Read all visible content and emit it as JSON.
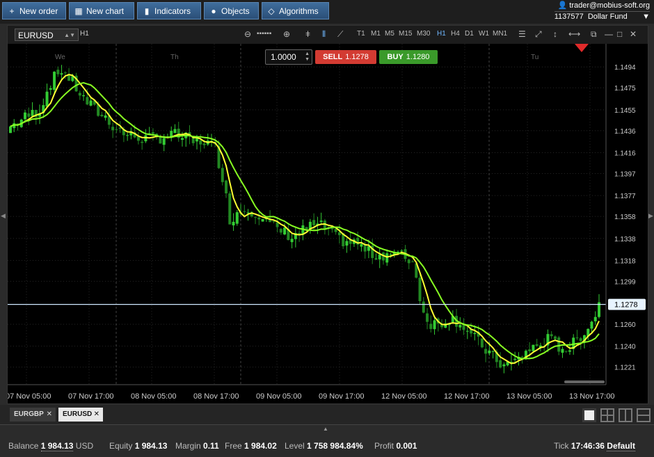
{
  "toolbar": {
    "new_order": "New order",
    "new_chart": "New chart",
    "indicators": "Indicators",
    "objects": "Objects",
    "algorithms": "Algorithms"
  },
  "account": {
    "user": "trader@mobius-soft.org",
    "number": "1137577",
    "name": "Dollar Fund"
  },
  "chart": {
    "symbol": "EURUSD",
    "timeframe": "H1",
    "timeframes": [
      "T1",
      "M1",
      "M5",
      "M15",
      "M30",
      "H1",
      "H4",
      "D1",
      "W1",
      "MN1"
    ],
    "active_timeframe": "H1"
  },
  "trade": {
    "quantity": "1.0000",
    "sell_label": "SELL",
    "sell_price": "1.1278",
    "buy_label": "BUY",
    "buy_price": "1.1280"
  },
  "chart_data": {
    "type": "candlestick",
    "symbol": "EURUSD",
    "timeframe": "H1",
    "current_price": 1.1278,
    "ylim": [
      1.1205,
      1.1515
    ],
    "y_ticks": [
      "1.1494",
      "1.1475",
      "1.1455",
      "1.1436",
      "1.1416",
      "1.1397",
      "1.1377",
      "1.1358",
      "1.1338",
      "1.1318",
      "1.1299",
      "1.1260",
      "1.1240",
      "1.1221"
    ],
    "x_ticks": [
      "07 Nov 05:00",
      "07 Nov 17:00",
      "08 Nov 05:00",
      "08 Nov 17:00",
      "09 Nov 05:00",
      "09 Nov 17:00",
      "12 Nov 05:00",
      "12 Nov 17:00",
      "13 Nov 05:00",
      "13 Nov 17:00"
    ],
    "day_labels": [
      "We",
      "Th",
      "Tu"
    ],
    "price_path": [
      [
        0,
        1.144
      ],
      [
        4,
        1.1448
      ],
      [
        8,
        1.1455
      ],
      [
        11,
        1.148
      ],
      [
        14,
        1.1492
      ],
      [
        17,
        1.148
      ],
      [
        20,
        1.1465
      ],
      [
        23,
        1.1455
      ],
      [
        26,
        1.1448
      ],
      [
        29,
        1.1438
      ],
      [
        32,
        1.1432
      ],
      [
        35,
        1.143
      ],
      [
        38,
        1.1428
      ],
      [
        41,
        1.143
      ],
      [
        44,
        1.1433
      ],
      [
        47,
        1.143
      ],
      [
        50,
        1.1425
      ],
      [
        53,
        1.1427
      ],
      [
        56,
        1.142
      ],
      [
        58,
        1.1395
      ],
      [
        60,
        1.1355
      ],
      [
        62,
        1.1362
      ],
      [
        65,
        1.1366
      ],
      [
        68,
        1.136
      ],
      [
        71,
        1.135
      ],
      [
        74,
        1.1345
      ],
      [
        77,
        1.134
      ],
      [
        80,
        1.1345
      ],
      [
        83,
        1.135
      ],
      [
        86,
        1.1348
      ],
      [
        89,
        1.1338
      ],
      [
        92,
        1.1335
      ],
      [
        95,
        1.1333
      ],
      [
        98,
        1.1325
      ],
      [
        101,
        1.1323
      ],
      [
        104,
        1.1325
      ],
      [
        107,
        1.1322
      ],
      [
        110,
        1.1318
      ],
      [
        112,
        1.1285
      ],
      [
        114,
        1.1262
      ],
      [
        117,
        1.126
      ],
      [
        120,
        1.1266
      ],
      [
        123,
        1.1262
      ],
      [
        126,
        1.125
      ],
      [
        129,
        1.124
      ],
      [
        132,
        1.123
      ],
      [
        135,
        1.1222
      ],
      [
        138,
        1.1226
      ],
      [
        141,
        1.1235
      ],
      [
        144,
        1.124
      ],
      [
        147,
        1.1246
      ],
      [
        150,
        1.124
      ],
      [
        153,
        1.1238
      ],
      [
        156,
        1.125
      ],
      [
        159,
        1.1262
      ],
      [
        161,
        1.1278
      ]
    ],
    "bars": 162
  },
  "tabs": [
    {
      "label": "EURGBP",
      "close": "✕"
    },
    {
      "label": "EURUSD",
      "close": "✕"
    }
  ],
  "status": {
    "balance_label": "Balance",
    "balance": "1 984.13",
    "currency": "USD",
    "equity_label": "Equity",
    "equity": "1 984.13",
    "margin_label": "Margin",
    "margin": "0.11",
    "free_label": "Free",
    "free": "1 984.02",
    "level_label": "Level",
    "level": "1 758 984.84%",
    "profit_label": "Profit",
    "profit": "0.001",
    "tick_label": "Tick",
    "tick": "17:46:36",
    "tick_mode": "Default"
  },
  "colors": {
    "bull_candle": "#33cc33",
    "bear_candle": "#228822",
    "ma_fast": "#ffff33",
    "ma_slow": "#88ff22",
    "price_line": "#cfe8ff",
    "sell": "#d33b32",
    "buy": "#3a9a2a"
  }
}
